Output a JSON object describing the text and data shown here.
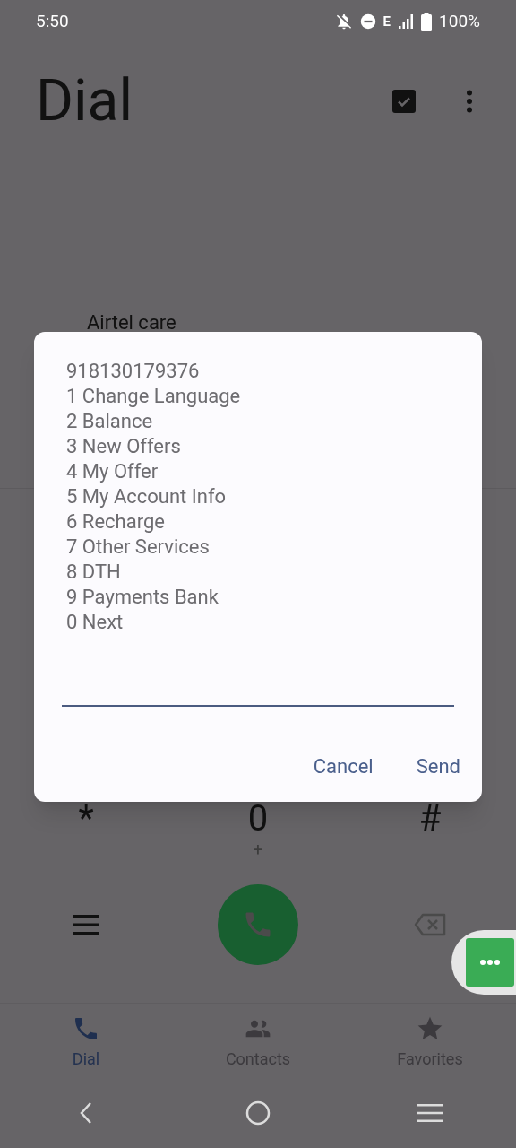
{
  "status_bar": {
    "time": "5:50",
    "network": "E",
    "battery": "100%"
  },
  "header": {
    "title": "Dial"
  },
  "contact": {
    "name": "Airtel care"
  },
  "keypad_row": [
    {
      "key": "*"
    },
    {
      "key": "0",
      "sub": "+"
    },
    {
      "key": "#"
    }
  ],
  "nav_tabs": [
    {
      "label": "Dial",
      "kind": "phone",
      "selected": true
    },
    {
      "label": "Contacts",
      "kind": "people",
      "selected": false
    },
    {
      "label": "Favorites",
      "kind": "star",
      "selected": false
    }
  ],
  "dialog": {
    "lines": [
      "918130179376",
      "1 Change Language",
      "2 Balance",
      "3 New Offers",
      "4 My Offer",
      "5 My Account Info",
      "6 Recharge",
      "7 Other Services",
      "8 DTH",
      "9 Payments Bank",
      "0 Next"
    ],
    "buttons": [
      "Cancel",
      "Send"
    ]
  }
}
